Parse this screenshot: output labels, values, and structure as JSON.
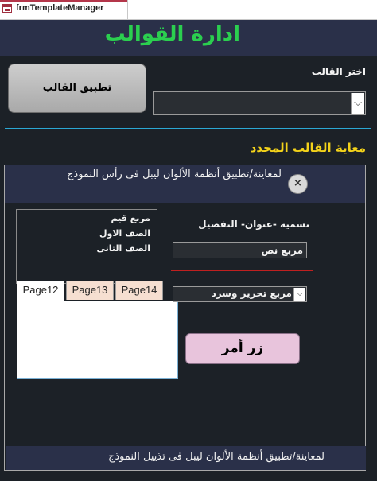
{
  "tab": {
    "title": "frmTemplateManager"
  },
  "header": {
    "title": "ادارة القوالب"
  },
  "template_picker": {
    "label": "اختر القالب",
    "value": ""
  },
  "apply_button": {
    "label": "تطبيق القالب"
  },
  "preview": {
    "title": "معاية القالب المحدد",
    "header_text": "لمعاينة/تطبيق أنظمة الألوان ليبل فى رأس النموذج",
    "close_label": "×",
    "list_items": [
      "مربع قيم",
      "الصف الاول",
      "الصف الثانى"
    ],
    "caption_label": "تسمية -عنوان-  التفصيل",
    "textbox_value": "مربع نص",
    "tabs": [
      "Page12",
      "Page13",
      "Page14"
    ],
    "combo_value": "مربع تحرير وسرد",
    "command_button": "زر أمر",
    "footer_text": "لمعاينة/تطبيق أنظمة الألوان ليبل فى تذييل النموذج"
  },
  "colors": {
    "form_bg": "#1c2127",
    "band_bg": "#2a3049",
    "title_green": "#2bcf4f",
    "section_yellow": "#f3d21a",
    "divider_blue": "#2ba8d4"
  }
}
